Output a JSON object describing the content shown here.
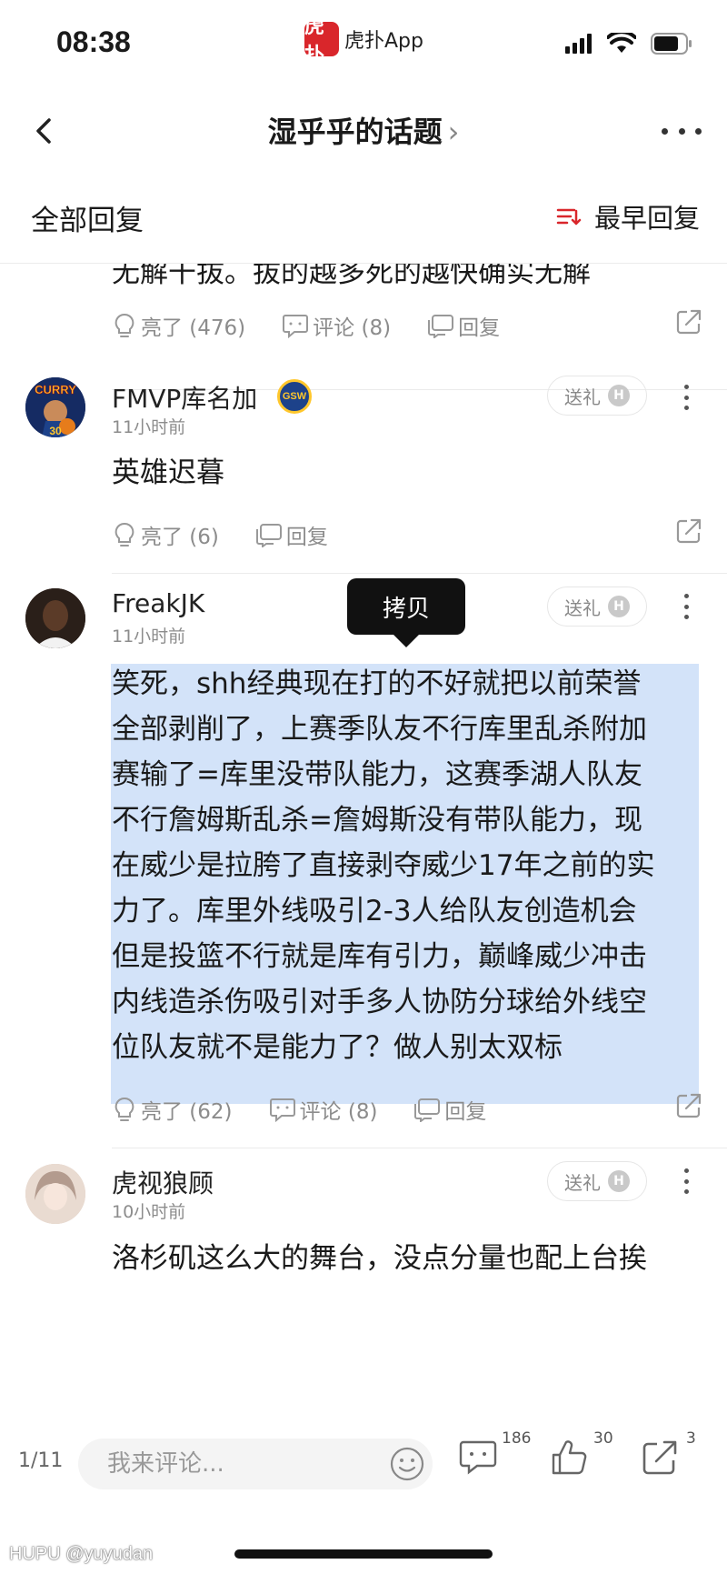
{
  "status_bar": {
    "time": "08:38",
    "app_logo_text": "虎扑",
    "app_name": "虎扑App"
  },
  "nav": {
    "title": "湿乎乎的话题",
    "title_chevron": "›"
  },
  "sort": {
    "left_label": "全部回复",
    "right_label": "最早回复"
  },
  "replies": [
    {
      "text": "无解干拔。拔的越多死的越快确实无解",
      "actions": {
        "like": "亮了 (476)",
        "comment": "评论 (8)",
        "reply": "回复"
      }
    },
    {
      "username": "FMVP库名加",
      "badge": "GSW",
      "time": "11小时前",
      "gift": "送礼",
      "gift_badge": "H",
      "avatar_text": "CURRY",
      "avatar_number": "30",
      "text": "英雄迟暮",
      "actions": {
        "like": "亮了 (6)",
        "reply": "回复"
      }
    },
    {
      "username": "FreakJK",
      "time": "11小时前",
      "gift": "送礼",
      "gift_badge": "H",
      "copy_popup": "拷贝",
      "lines": [
        "笑死，shh经典现在打的不好就把以前荣誉",
        "全部剥削了，上赛季队友不行库里乱杀附加",
        "赛输了=库里没带队能力，这赛季湖人队友",
        "不行詹姆斯乱杀=詹姆斯没有带队能力，现",
        "在威少是拉胯了直接剥夺威少17年之前的实",
        "力了。库里外线吸引2-3人给队友创造机会",
        "但是投篮不行就是库有引力，巅峰威少冲击",
        "内线造杀伤吸引对手多人协防分球给外线空",
        "位队友就不是能力了？做人别太双标"
      ],
      "actions": {
        "like": "亮了 (62)",
        "comment": "评论 (8)",
        "reply": "回复"
      }
    },
    {
      "username": "虎视狼顾",
      "time": "10小时前",
      "gift": "送礼",
      "gift_badge": "H",
      "text": "洛杉矶这么大的舞台，没点分量也配上台挨"
    }
  ],
  "bottom_bar": {
    "page_indicator": "1/11",
    "input_placeholder": "我来评论...",
    "comment_count": "186",
    "like_count": "30",
    "share_count": "3"
  },
  "watermark": "HUPU @yuyudan",
  "colors": {
    "highlight": "#d3e3f9",
    "accent_red": "#d9262b",
    "muted": "#8c8c8c"
  }
}
